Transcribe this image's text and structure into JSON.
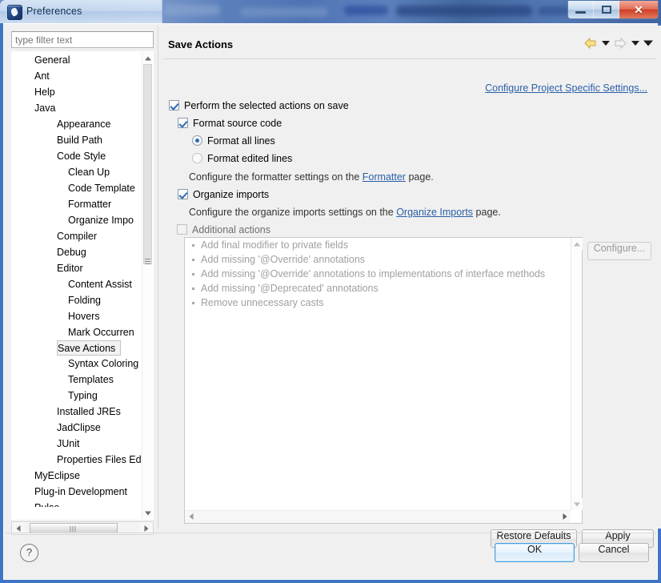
{
  "window": {
    "title": "Preferences",
    "icon": "eclipse-icon",
    "controls": {
      "minimize": "–",
      "maximize": "□",
      "close": "✕"
    }
  },
  "sidebar": {
    "filter": {
      "placeholder": "type filter text",
      "value": ""
    },
    "items": [
      {
        "label": "General",
        "level": 1,
        "selected": false
      },
      {
        "label": "Ant",
        "level": 1,
        "selected": false
      },
      {
        "label": "Help",
        "level": 1,
        "selected": false
      },
      {
        "label": "Java",
        "level": 1,
        "selected": false
      },
      {
        "label": "Appearance",
        "level": 2,
        "selected": false
      },
      {
        "label": "Build Path",
        "level": 2,
        "selected": false
      },
      {
        "label": "Code Style",
        "level": 2,
        "selected": false
      },
      {
        "label": "Clean Up",
        "level": 3,
        "selected": false
      },
      {
        "label": "Code Template",
        "level": 3,
        "selected": false
      },
      {
        "label": "Formatter",
        "level": 3,
        "selected": false
      },
      {
        "label": "Organize Impo",
        "level": 3,
        "selected": false
      },
      {
        "label": "Compiler",
        "level": 2,
        "selected": false
      },
      {
        "label": "Debug",
        "level": 2,
        "selected": false
      },
      {
        "label": "Editor",
        "level": 2,
        "selected": false
      },
      {
        "label": "Content Assist",
        "level": 3,
        "selected": false
      },
      {
        "label": "Folding",
        "level": 3,
        "selected": false
      },
      {
        "label": "Hovers",
        "level": 3,
        "selected": false
      },
      {
        "label": "Mark Occurren",
        "level": 3,
        "selected": false
      },
      {
        "label": "Save Actions",
        "level": 3,
        "selected": true
      },
      {
        "label": "Syntax Coloring",
        "level": 3,
        "selected": false
      },
      {
        "label": "Templates",
        "level": 3,
        "selected": false
      },
      {
        "label": "Typing",
        "level": 3,
        "selected": false
      },
      {
        "label": "Installed JREs",
        "level": 2,
        "selected": false
      },
      {
        "label": "JadClipse",
        "level": 2,
        "selected": false
      },
      {
        "label": "JUnit",
        "level": 2,
        "selected": false
      },
      {
        "label": "Properties Files Ed",
        "level": 2,
        "selected": false
      },
      {
        "label": "MyEclipse",
        "level": 1,
        "selected": false
      },
      {
        "label": "Plug-in Development",
        "level": 1,
        "selected": false
      },
      {
        "label": "Pulse",
        "level": 1,
        "selected": false
      }
    ]
  },
  "page": {
    "title": "Save Actions",
    "project_link": "Configure Project Specific Settings...",
    "nav": {
      "back_icon": "back-arrow-icon",
      "back_dropdown_icon": "chevron-down-icon",
      "forward_icon": "forward-arrow-icon",
      "forward_dropdown_icon": "chevron-down-icon",
      "menu_icon": "chevron-down-icon"
    },
    "options": {
      "perform_on_save": {
        "label": "Perform the selected actions on save",
        "checked": true
      },
      "format_source": {
        "label": "Format source code",
        "checked": true
      },
      "format_all_lines": {
        "label": "Format all lines",
        "selected": true
      },
      "format_edited_lines": {
        "label": "Format edited lines",
        "selected": false
      },
      "formatter_hint_before": "Configure the formatter settings on the ",
      "formatter_link": "Formatter",
      "formatter_hint_after": " page.",
      "organize_imports": {
        "label": "Organize imports",
        "checked": true
      },
      "organize_hint_before": "Configure the organize imports settings on the ",
      "organize_link": "Organize Imports",
      "organize_hint_after": " page.",
      "additional_actions": {
        "label": "Additional actions",
        "checked": false
      }
    },
    "action_list": [
      "Add final modifier to private fields",
      "Add missing '@Override' annotations",
      "Add missing '@Override' annotations to implementations of interface methods",
      "Add missing '@Deprecated' annotations",
      "Remove unnecessary casts"
    ],
    "buttons": {
      "configure": "Configure...",
      "restore_defaults": "Restore Defaults",
      "apply": "Apply"
    }
  },
  "footer": {
    "help_icon": "?",
    "ok": "OK",
    "cancel": "Cancel"
  },
  "colors": {
    "link": "#2a5fa8",
    "title_bar": "#cfe0f2",
    "dialog_border": "#3f76c4",
    "accent_check": "#2f6ab4",
    "disabled_text": "#a0a0a0"
  }
}
